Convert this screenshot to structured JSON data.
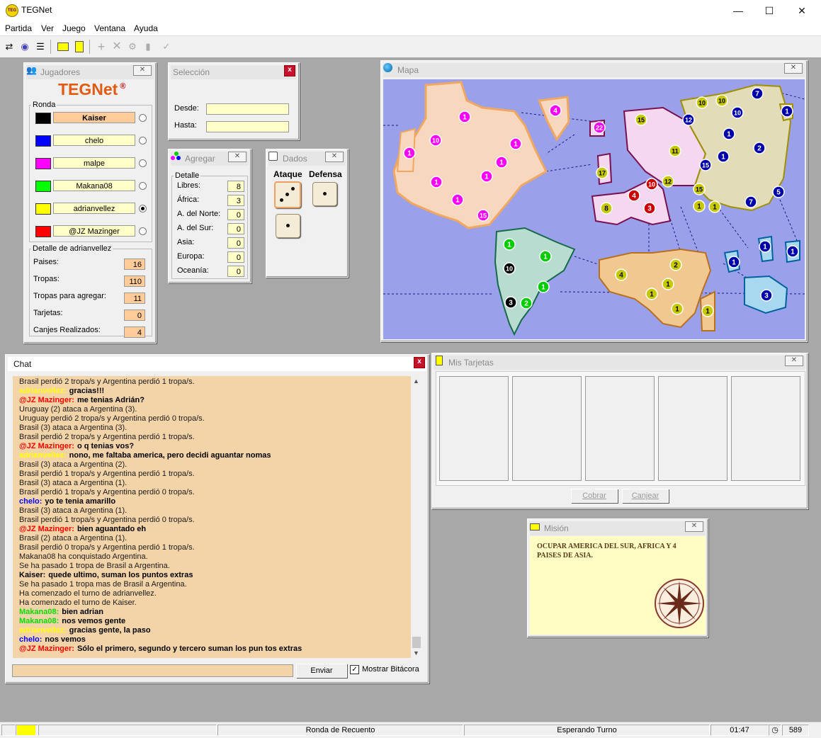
{
  "window": {
    "title": "TEGNet",
    "minimize": "—",
    "maximize": "☐",
    "close": "✕"
  },
  "menu": [
    "Partida",
    "Ver",
    "Juego",
    "Ventana",
    "Ayuda"
  ],
  "players_panel": {
    "title": "Jugadores",
    "logo": "TEGNet",
    "logo_mark": "®",
    "round_label": "Ronda",
    "players": [
      {
        "name": "Kaiser",
        "color": "#000000",
        "current": true,
        "selected": false
      },
      {
        "name": "chelo",
        "color": "#0000ff",
        "current": false,
        "selected": false
      },
      {
        "name": "malpe",
        "color": "#ff00ff",
        "current": false,
        "selected": false
      },
      {
        "name": "Makana08",
        "color": "#00ff00",
        "current": false,
        "selected": false
      },
      {
        "name": "adrianvellez",
        "color": "#ffff00",
        "current": false,
        "selected": true
      },
      {
        "name": "@JZ Mazinger",
        "color": "#ff0000",
        "current": false,
        "selected": false
      }
    ],
    "detail_title": "Detalle de adrianvellez",
    "details": [
      {
        "label": "Paises:",
        "value": "16"
      },
      {
        "label": "Tropas:",
        "value": "110"
      },
      {
        "label": "Tropas para agregar:",
        "value": "11"
      },
      {
        "label": "Tarjetas:",
        "value": "0"
      },
      {
        "label": "Canjes Realizados:",
        "value": "4"
      }
    ]
  },
  "selection_panel": {
    "title": "Selección",
    "from_label": "Desde:",
    "to_label": "Hasta:",
    "from_value": "",
    "to_value": ""
  },
  "add_panel": {
    "title": "Agregar",
    "detail_legend": "Detalle",
    "rows": [
      {
        "label": "Libres:",
        "value": "8"
      },
      {
        "label": "África:",
        "value": "3"
      },
      {
        "label": "A. del Norte:",
        "value": "0"
      },
      {
        "label": "A. del Sur:",
        "value": "0"
      },
      {
        "label": "Asia:",
        "value": "0"
      },
      {
        "label": "Europa:",
        "value": "0"
      },
      {
        "label": "Oceanía:",
        "value": "0"
      }
    ]
  },
  "dice_panel": {
    "title": "Dados",
    "attack_label": "Ataque",
    "defense_label": "Defensa",
    "attack_dice": [
      3,
      1
    ],
    "defense_dice": [
      1
    ]
  },
  "map_panel": {
    "title": "Mapa",
    "armies": [
      {
        "n": "1",
        "c": "#ff00ff"
      },
      {
        "n": "4",
        "c": "#ff00ff"
      },
      {
        "n": "1",
        "c": "#ff00ff"
      },
      {
        "n": "10",
        "c": "#ff00ff"
      },
      {
        "n": "1",
        "c": "#ff00ff"
      },
      {
        "n": "1",
        "c": "#ff00ff"
      },
      {
        "n": "1",
        "c": "#ff00ff"
      },
      {
        "n": "1",
        "c": "#ff00ff"
      },
      {
        "n": "1",
        "c": "#ff00ff"
      },
      {
        "n": "15",
        "c": "#ff00ff"
      },
      {
        "n": "22",
        "c": "#ff00ff"
      },
      {
        "n": "1",
        "c": "#00cc00"
      },
      {
        "n": "1",
        "c": "#00cc00"
      },
      {
        "n": "10",
        "c": "#000000"
      },
      {
        "n": "1",
        "c": "#00cc00"
      },
      {
        "n": "3",
        "c": "#000000"
      },
      {
        "n": "2",
        "c": "#00cc00"
      },
      {
        "n": "15",
        "c": "#c8c800"
      },
      {
        "n": "11",
        "c": "#c8c800"
      },
      {
        "n": "17",
        "c": "#c8c800"
      },
      {
        "n": "8",
        "c": "#c8c800"
      },
      {
        "n": "4",
        "c": "#cc0000"
      },
      {
        "n": "10",
        "c": "#cc0000"
      },
      {
        "n": "12",
        "c": "#c8c800"
      },
      {
        "n": "3",
        "c": "#cc0000"
      },
      {
        "n": "10",
        "c": "#c8c800"
      },
      {
        "n": "10",
        "c": "#c8c800"
      },
      {
        "n": "12",
        "c": "#0000aa"
      },
      {
        "n": "10",
        "c": "#0000aa"
      },
      {
        "n": "7",
        "c": "#0000aa"
      },
      {
        "n": "1",
        "c": "#0000aa"
      },
      {
        "n": "1",
        "c": "#0000aa"
      },
      {
        "n": "2",
        "c": "#0000aa"
      },
      {
        "n": "1",
        "c": "#0000aa"
      },
      {
        "n": "15",
        "c": "#0000aa"
      },
      {
        "n": "15",
        "c": "#c8c800"
      },
      {
        "n": "1",
        "c": "#c8c800"
      },
      {
        "n": "1",
        "c": "#c8c800"
      },
      {
        "n": "7",
        "c": "#0000aa"
      },
      {
        "n": "5",
        "c": "#0000aa"
      },
      {
        "n": "4",
        "c": "#c8c800"
      },
      {
        "n": "2",
        "c": "#c8c800"
      },
      {
        "n": "1",
        "c": "#c8c800"
      },
      {
        "n": "1",
        "c": "#c8c800"
      },
      {
        "n": "1",
        "c": "#c8c800"
      },
      {
        "n": "1",
        "c": "#c8c800"
      },
      {
        "n": "1",
        "c": "#0000aa"
      },
      {
        "n": "1",
        "c": "#0000aa"
      },
      {
        "n": "1",
        "c": "#0000aa"
      },
      {
        "n": "3",
        "c": "#0000aa"
      }
    ]
  },
  "cards_panel": {
    "title": "Mis Tarjetas",
    "collect_button": "Cobrar",
    "exchange_button": "Canjear"
  },
  "mission_panel": {
    "title": "Misión",
    "text": "OCUPAR AMERICA DEL SUR, AFRICA Y 4 PAISES DE ASIA."
  },
  "chat": {
    "title": "Chat",
    "lines": [
      {
        "type": "sys",
        "text": "Brasil perdió 2 tropa/s y Argentina perdió 1 tropa/s."
      },
      {
        "type": "msg",
        "nick": "adrianvellez:",
        "color": "#ffff00",
        "text": "gracias!!!"
      },
      {
        "type": "msg",
        "nick": "@JZ Mazinger:",
        "color": "#ff0000",
        "text": "me tenias Adrián?"
      },
      {
        "type": "sys",
        "text": "Uruguay (2) ataca a Argentina (3)."
      },
      {
        "type": "sys",
        "text": "Uruguay perdió 2 tropa/s y Argentina perdió 0 tropa/s."
      },
      {
        "type": "sys",
        "text": "Brasil (3) ataca a Argentina (3)."
      },
      {
        "type": "sys",
        "text": "Brasil perdió 2 tropa/s y Argentina perdió 1 tropa/s."
      },
      {
        "type": "msg",
        "nick": "@JZ Mazinger:",
        "color": "#ff0000",
        "text": "o q tenias vos?"
      },
      {
        "type": "msg",
        "nick": "adrianvellez:",
        "color": "#ffff00",
        "text": "nono, me faltaba america, pero decidi aguantar nomas"
      },
      {
        "type": "sys",
        "text": "Brasil (3) ataca a Argentina (2)."
      },
      {
        "type": "sys",
        "text": "Brasil perdió 1 tropa/s y Argentina perdió 1 tropa/s."
      },
      {
        "type": "sys",
        "text": "Brasil (3) ataca a Argentina (1)."
      },
      {
        "type": "sys",
        "text": "Brasil perdió 1 tropa/s y Argentina perdió 0 tropa/s."
      },
      {
        "type": "msg",
        "nick": "chelo:",
        "color": "#0000ff",
        "text": "yo te tenia amarillo"
      },
      {
        "type": "sys",
        "text": "Brasil (3) ataca a Argentina (1)."
      },
      {
        "type": "sys",
        "text": "Brasil perdió 1 tropa/s y Argentina perdió 0 tropa/s."
      },
      {
        "type": "msg",
        "nick": "@JZ Mazinger:",
        "color": "#ff0000",
        "text": "bien aguantado eh"
      },
      {
        "type": "sys",
        "text": "Brasil (2) ataca a Argentina (1)."
      },
      {
        "type": "sys",
        "text": "Brasil perdió 0 tropa/s y Argentina perdió 1 tropa/s."
      },
      {
        "type": "sys",
        "text": "Makana08 ha conquistado Argentina."
      },
      {
        "type": "sys",
        "text": "Se ha pasado 1 tropa de Brasil a Argentina."
      },
      {
        "type": "msg",
        "nick": "Kaiser:",
        "color": "#000000",
        "text": "quede ultimo, suman los puntos extras"
      },
      {
        "type": "sys",
        "text": "Se ha pasado 1 tropa mas de Brasil a Argentina."
      },
      {
        "type": "sys",
        "text": "Ha comenzado el turno de adrianvellez."
      },
      {
        "type": "sys",
        "text": "Ha comenzado el turno de Kaiser."
      },
      {
        "type": "msg",
        "nick": "Makana08:",
        "color": "#00dd00",
        "text": "bien adrian"
      },
      {
        "type": "msg",
        "nick": "Makana08:",
        "color": "#00dd00",
        "text": "nos vemos gente"
      },
      {
        "type": "msg",
        "nick": "adrianvellez:",
        "color": "#ffff00",
        "text": "gracias gente, la paso"
      },
      {
        "type": "msg",
        "nick": "chelo:",
        "color": "#0000ff",
        "text": "nos vemos"
      },
      {
        "type": "msg",
        "nick": "@JZ Mazinger:",
        "color": "#ff0000",
        "text": "Sólo el primero, segundo y tercero suman los pun tos extras"
      }
    ],
    "input_value": "",
    "send_button": "Enviar",
    "show_log_label": "Mostrar Bitácora",
    "show_log_checked": true
  },
  "status": {
    "color": "#ffff00",
    "round": "Ronda de Recuento",
    "state": "Esperando Turno",
    "time": "01:47",
    "count": "589"
  }
}
